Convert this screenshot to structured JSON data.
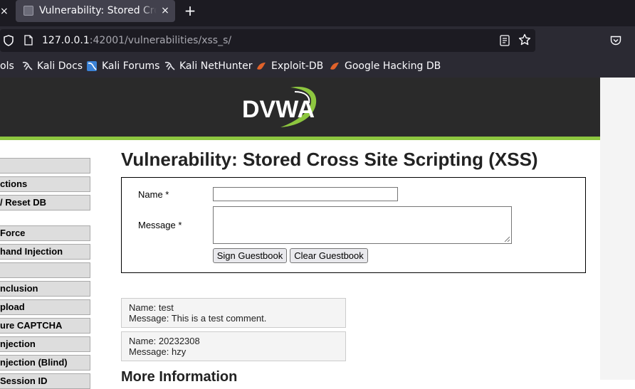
{
  "browser": {
    "tab_close_left": "×",
    "tab_title": "Vulnerability: Stored Cross Site Scripting (XSS)",
    "tab_close": "×",
    "new_tab": "+",
    "url_host": "127.0.0.1",
    "url_rest": ":42001/vulnerabilities/xss_s/"
  },
  "bookmarks": [
    {
      "label": "ols",
      "icon": "kali-tools-icon"
    },
    {
      "label": "Kali Docs",
      "icon": "kali-dragon-icon"
    },
    {
      "label": "Kali Forums",
      "icon": "kali-forums-icon"
    },
    {
      "label": "Kali NetHunter",
      "icon": "kali-dragon-icon"
    },
    {
      "label": "Exploit-DB",
      "icon": "exploit-db-icon"
    },
    {
      "label": "Google Hacking DB",
      "icon": "exploit-db-icon"
    }
  ],
  "colors": {
    "header_bg": "#2a2a2a",
    "header_stripe": "#8dc63f",
    "menu_bg": "#dddddd"
  },
  "logo": {
    "text": "DVWA"
  },
  "menu": [
    {
      "label": ""
    },
    {
      "label": "ctions"
    },
    {
      "label": " / Reset DB"
    },
    {
      "label": " Force"
    },
    {
      "label": "hand Injection"
    },
    {
      "label": ""
    },
    {
      "label": "nclusion"
    },
    {
      "label": "pload"
    },
    {
      "label": "ure CAPTCHA"
    },
    {
      "label": "njection"
    },
    {
      "label": "njection (Blind)"
    },
    {
      "label": " Session ID"
    }
  ],
  "main": {
    "title": "Vulnerability: Stored Cross Site Scripting (XSS)",
    "name_label": "Name *",
    "message_label": "Message *",
    "name_value": "",
    "message_value": "",
    "sign_button": "Sign Guestbook",
    "clear_button": "Clear Guestbook",
    "entries": [
      {
        "name": "Name: test",
        "message": "Message: This is a test comment."
      },
      {
        "name": "Name: 20232308",
        "message": "Message: hzy"
      }
    ],
    "more_info": "More Information"
  }
}
